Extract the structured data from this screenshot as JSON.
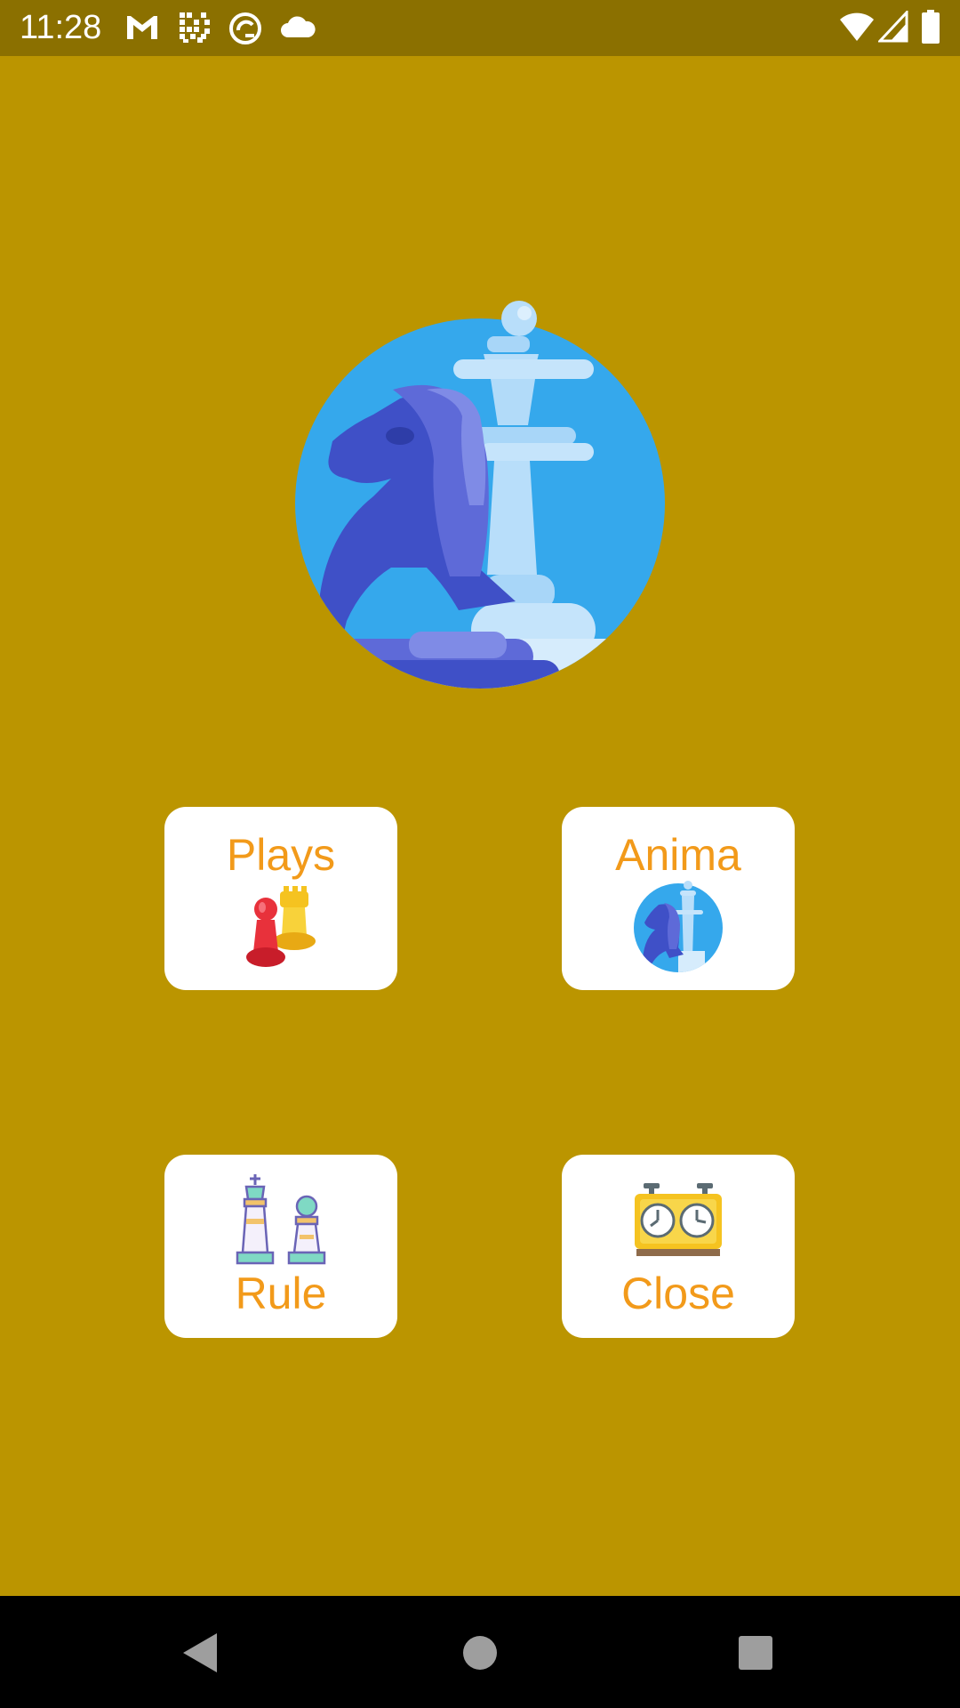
{
  "status_bar": {
    "time": "11:28",
    "icons": [
      "gmail-icon",
      "qr-grid-icon",
      "sync-circle-icon",
      "cloud-icon",
      "wifi-icon",
      "signal-icon",
      "battery-icon"
    ],
    "color": "#8B7000"
  },
  "app": {
    "background_color": "#BB9500",
    "hero_image": "chess-knight-queen-icon"
  },
  "menu": {
    "label_color": "#F29A1A",
    "card_color": "#FFFFFF",
    "items": [
      {
        "label": "Plays",
        "icon": "pawns-icon"
      },
      {
        "label": "Anima",
        "icon": "chess-knight-queen-icon"
      },
      {
        "label": "Rule",
        "icon": "chess-king-pawn-icon"
      },
      {
        "label": "Close",
        "icon": "chess-clock-icon"
      }
    ]
  },
  "nav_bar": {
    "buttons": [
      "back-icon",
      "home-icon",
      "recents-icon"
    ]
  }
}
